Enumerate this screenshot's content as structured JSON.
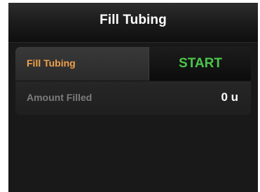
{
  "header": {
    "title": "Fill Tubing"
  },
  "fill_row": {
    "label": "Fill Tubing",
    "button_label": "START"
  },
  "amount_row": {
    "label": "Amount Filled",
    "value": "0 u"
  },
  "colors": {
    "label_accent": "#f0a14a",
    "start_green": "#4cc54a",
    "background": "#000000"
  }
}
